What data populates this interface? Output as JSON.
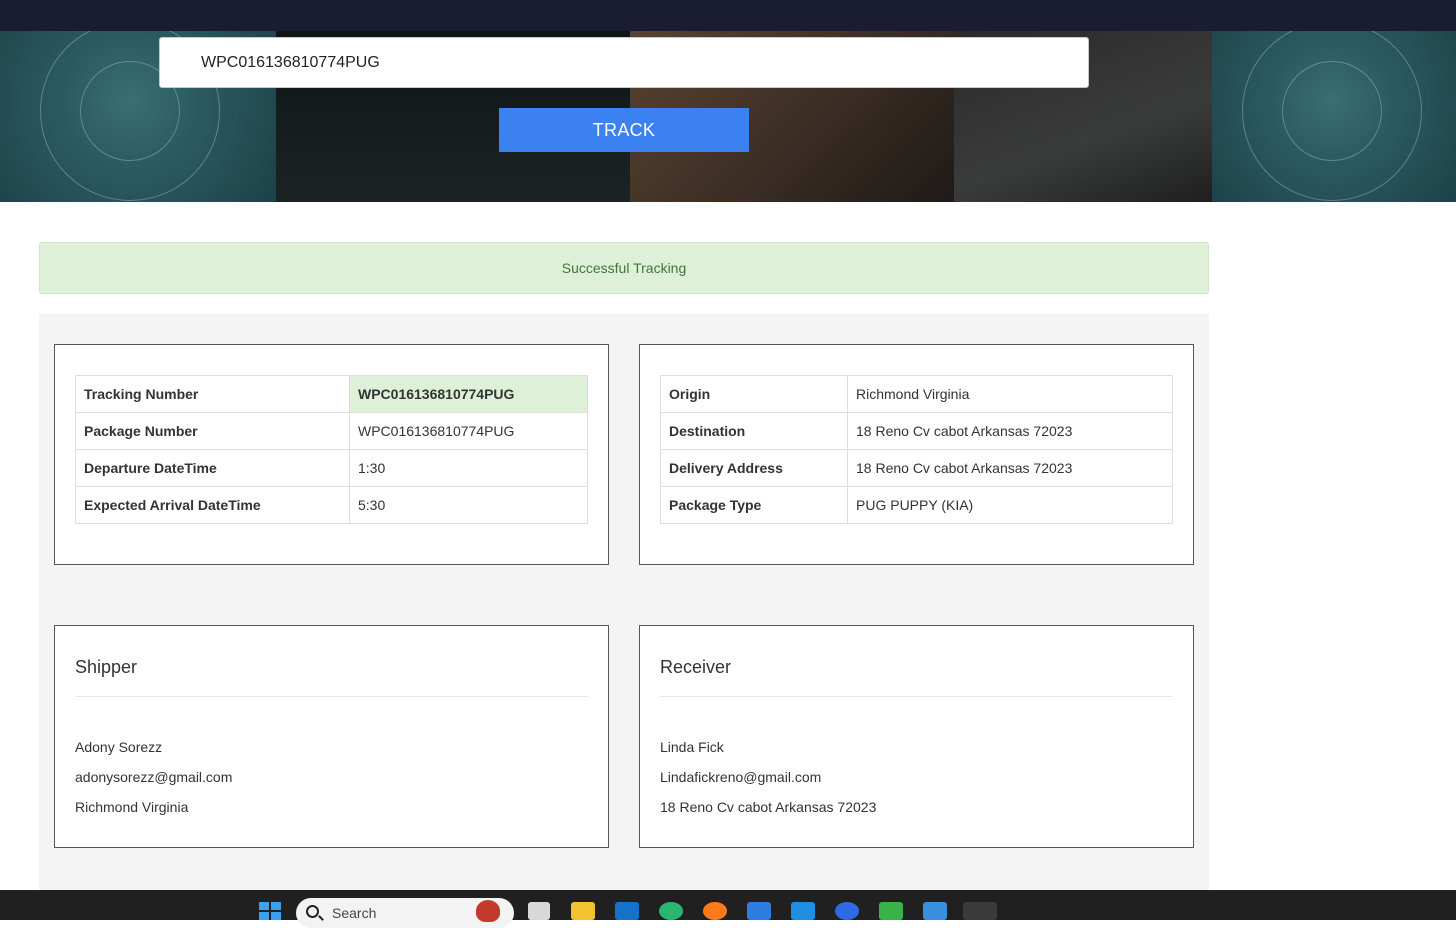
{
  "search": {
    "value": "WPC016136810774PUG",
    "track_label": "TRACK"
  },
  "alert": {
    "message": "Successful Tracking"
  },
  "shipment": {
    "rows": [
      {
        "label": "Tracking Number",
        "value": "WPC016136810774PUG",
        "highlight": true
      },
      {
        "label": "Package Number",
        "value": "WPC016136810774PUG"
      },
      {
        "label": "Departure DateTime",
        "value": "1:30"
      },
      {
        "label": "Expected Arrival DateTime",
        "value": "5:30"
      }
    ]
  },
  "route": {
    "rows": [
      {
        "label": "Origin",
        "value": "Richmond Virginia"
      },
      {
        "label": "Destination",
        "value": "18 Reno Cv cabot Arkansas 72023"
      },
      {
        "label": "Delivery Address",
        "value": "18 Reno Cv cabot Arkansas 72023"
      },
      {
        "label": "Package Type",
        "value": "PUG PUPPY (KIA)"
      }
    ]
  },
  "shipper": {
    "title": "Shipper",
    "name": "Adony Sorezz",
    "email": "adonysorezz@gmail.com",
    "address": "Richmond Virginia"
  },
  "receiver": {
    "title": "Receiver",
    "name": "Linda Fick",
    "email": "Lindafickreno@gmail.com",
    "address": "18 Reno Cv cabot Arkansas 72023"
  },
  "taskbar": {
    "search_label": "Search",
    "icons": [
      "start-icon",
      "task-view-icon",
      "file-explorer-icon",
      "outlook-icon",
      "chrome-profile-icon",
      "firefox-icon",
      "store-icon",
      "onedrive-icon",
      "zoom-icon",
      "pycharm-icon",
      "photos-icon",
      "snipping-tool-icon"
    ]
  },
  "colors": {
    "accent": "#3b82f0",
    "success_bg": "#dff0d8",
    "success_text": "#3c763d",
    "topbar": "#1a1c33"
  }
}
